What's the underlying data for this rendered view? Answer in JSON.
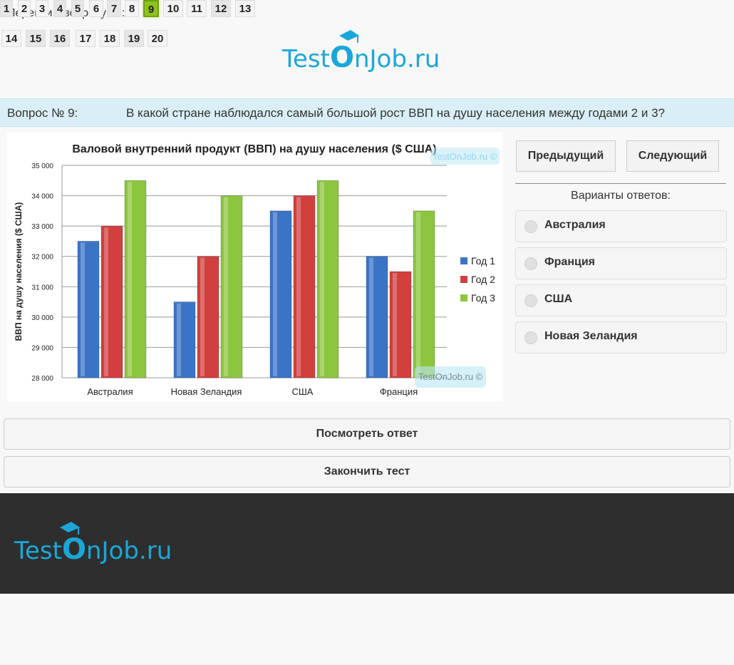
{
  "nav": {
    "goto_label": "Перейти к вопросу №:",
    "questions": [
      "1",
      "2",
      "3",
      "4",
      "5",
      "6",
      "7",
      "8",
      "9",
      "10",
      "11",
      "12",
      "13",
      "14",
      "15",
      "16",
      "17",
      "18",
      "19",
      "20"
    ],
    "current": "9"
  },
  "brand": {
    "logo_text_test": "Test",
    "logo_text_o": "O",
    "logo_text_rest": "nJob.ru"
  },
  "question": {
    "number_label": "Вопрос № 9:",
    "text": "В какой стране наблюдался самый большой рост ВВП на душу населения между годами 2 и 3?"
  },
  "buttons": {
    "prev": "Предыдущий",
    "next": "Следующий",
    "show_answer": "Посмотреть ответ",
    "finish": "Закончить тест"
  },
  "answers": {
    "label": "Варианты ответов:",
    "options": [
      "Австралия",
      "Франция",
      "США",
      "Новая Зеландия"
    ]
  },
  "chart_data": {
    "type": "bar",
    "title": "Валовой внутренний продукт (ВВП) на душу населения ($ США)",
    "ylabel": "ВВП на душу населения ($ США)",
    "xlabel": "",
    "categories": [
      "Австралия",
      "Новая Зеландия",
      "США",
      "Франция"
    ],
    "series": [
      {
        "name": "Год 1",
        "values": [
          32500,
          30500,
          33500,
          32000
        ],
        "color": "#3b74c7"
      },
      {
        "name": "Год 2",
        "values": [
          33000,
          32000,
          34000,
          31500
        ],
        "color": "#d23f3f"
      },
      {
        "name": "Год 3",
        "values": [
          34500,
          34000,
          34500,
          33500
        ],
        "color": "#8cc63e"
      }
    ],
    "ylim": [
      28000,
      35000
    ],
    "yticks": [
      "28 000",
      "29 000",
      "30 000",
      "31 000",
      "32 000",
      "33 000",
      "34 000",
      "35 000"
    ],
    "grid": true,
    "legend": "right",
    "watermark": "TestOnJob.ru ©"
  }
}
